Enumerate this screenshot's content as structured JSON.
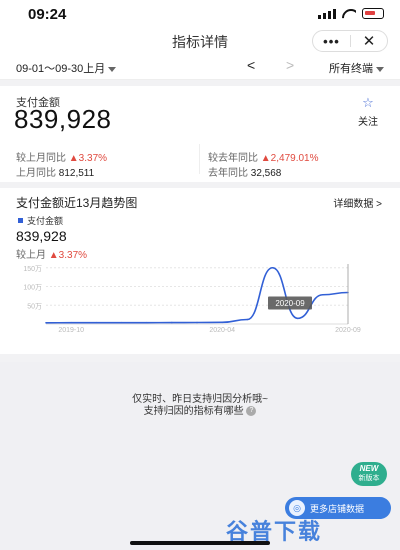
{
  "status": {
    "time": "09:24"
  },
  "nav": {
    "title": "指标详情",
    "more": "•••",
    "close": "✕"
  },
  "filter": {
    "date_range": "09-01～09-30上月",
    "prev": "<",
    "next": ">",
    "terminal": "所有终端"
  },
  "metric": {
    "label": "支付金额",
    "value": "839,928",
    "follow_icon": "☆",
    "follow_label": "关注",
    "mom_label": "较上月同比",
    "mom_change": "▲3.37%",
    "mom_base_label": "上月同比",
    "mom_base_value": "812,511",
    "yoy_label": "较去年同比",
    "yoy_change": "▲2,479.01%",
    "yoy_base_label": "去年同比",
    "yoy_base_value": "32,568"
  },
  "trend": {
    "title": "支付金额近13月趋势图",
    "detail": "详细数据 >",
    "legend": "支付金额",
    "value": "839,928",
    "cmp_label": "较上月",
    "cmp_change": "▲3.37%"
  },
  "chart_data": {
    "type": "line",
    "x": [
      "2019-09",
      "2019-10",
      "2019-11",
      "2019-12",
      "2020-01",
      "2020-02",
      "2020-03",
      "2020-04",
      "2020-05",
      "2020-06",
      "2020-07",
      "2020-08",
      "2020-09"
    ],
    "series": [
      {
        "name": "支付金额",
        "values": [
          33000,
          34000,
          36000,
          35000,
          36000,
          38000,
          40000,
          44000,
          120000,
          1500000,
          150000,
          780000,
          840000
        ]
      }
    ],
    "ylim": [
      0,
      1600000
    ],
    "y_ticks": [
      "50万",
      "100万",
      "150万"
    ],
    "x_tick_labels": [
      "2019-10",
      "2020-04",
      "2020-09"
    ],
    "tooltip": "2020-09",
    "color": "#3260d6",
    "grid": true
  },
  "info": {
    "line1": "仅实时、昨日支持归因分析哦~",
    "line2": "支持归因的指标有哪些",
    "help_icon": "?"
  },
  "badges": {
    "new_title": "NEW",
    "new_sub": "新版本",
    "more_stores": "更多店铺数据"
  },
  "watermark": "谷普下载"
}
